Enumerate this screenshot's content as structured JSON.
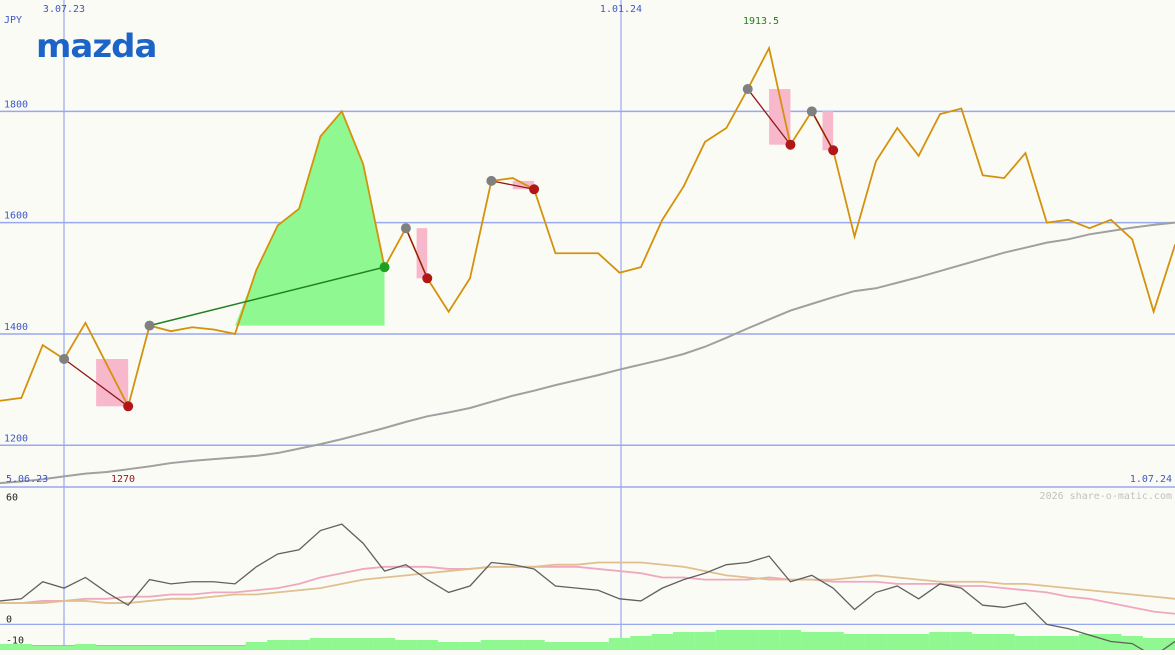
{
  "currency_label": "JPY",
  "logo_text": "mazda",
  "watermark": "2026 share-o-matic.com",
  "annotations": {
    "high_label": "1913.5",
    "low_label": "1270"
  },
  "colors": {
    "background": "#fbfbf6",
    "grid": "#9aa8f0",
    "price_line": "#d4920c",
    "moving_average": "#a0a0a0",
    "gain_fill": "#90f890",
    "loss_fill": "#f8b8cc",
    "logo_blue": "#1c64c8",
    "high_text": "#208020",
    "low_text": "#901818",
    "osc_main": "#606060",
    "osc_pink": "#f0a8c0",
    "osc_tan": "#e0c090",
    "volume": "#90f890"
  },
  "chart_data": [
    {
      "type": "line",
      "ylim": [
        1125,
        2000
      ],
      "yticks": [
        1200,
        1400,
        1600,
        1800
      ],
      "x_top_labels": [
        "3.07.23",
        "1.01.24"
      ],
      "x_bottom_labels": [
        "5.06.23",
        "1.07.24"
      ],
      "grid": true,
      "series": [
        {
          "role": "price",
          "values": [
            1280,
            1285,
            1380,
            1355,
            1420,
            1345,
            1270,
            1415,
            1405,
            1412,
            1408,
            1400,
            1515,
            1595,
            1625,
            1755,
            1800,
            1705,
            1520,
            1590,
            1500,
            1440,
            1500,
            1675,
            1680,
            1660,
            1545,
            1545,
            1545,
            1510,
            1520,
            1605,
            1665,
            1745,
            1770,
            1840,
            1913.5,
            1740,
            1800,
            1730,
            1575,
            1710,
            1770,
            1720,
            1795,
            1805,
            1685,
            1680,
            1725,
            1600,
            1605,
            1590,
            1605,
            1570,
            1440,
            1560
          ]
        },
        {
          "role": "moving-average",
          "values": [
            1132,
            1135,
            1139,
            1144,
            1149,
            1152,
            1157,
            1162,
            1168,
            1172,
            1175,
            1178,
            1181,
            1186,
            1194,
            1202,
            1211,
            1221,
            1231,
            1242,
            1252,
            1259,
            1267,
            1278,
            1289,
            1298,
            1308,
            1317,
            1326,
            1336,
            1345,
            1354,
            1364,
            1377,
            1393,
            1410,
            1426,
            1442,
            1454,
            1466,
            1477,
            1482,
            1492,
            1502,
            1513,
            1524,
            1535,
            1546,
            1555,
            1564,
            1570,
            1579,
            1585,
            1591,
            1596,
            1600
          ]
        }
      ],
      "swings": [
        {
          "from": 3,
          "to": 6,
          "kind": "loss"
        },
        {
          "from": 7,
          "to": 18,
          "kind": "gain"
        },
        {
          "from": 19,
          "to": 20,
          "kind": "loss"
        },
        {
          "from": 23,
          "to": 25,
          "kind": "loss"
        },
        {
          "from": 35,
          "to": 37,
          "kind": "loss"
        },
        {
          "from": 38,
          "to": 39,
          "kind": "loss"
        }
      ]
    },
    {
      "type": "line",
      "ylim": [
        -12,
        63
      ],
      "yticks": [
        60,
        0,
        -10
      ],
      "series": [
        {
          "role": "oscillator",
          "values": [
            11,
            12,
            20,
            17,
            22,
            15,
            9,
            21,
            19,
            20,
            20,
            19,
            27,
            33,
            35,
            44,
            47,
            38,
            25,
            28,
            21,
            15,
            18,
            29,
            28,
            26,
            18,
            17,
            16,
            12,
            11,
            17,
            21,
            24,
            28,
            29,
            32,
            20,
            23,
            17,
            7,
            15,
            18,
            12,
            19,
            17,
            9,
            8,
            10,
            0,
            -2,
            -5,
            -8,
            -9,
            -15,
            -8
          ]
        },
        {
          "role": "signal-pink",
          "values": [
            10,
            10,
            11,
            11,
            12,
            12,
            13,
            13,
            14,
            14,
            15,
            15,
            16,
            17,
            19,
            22,
            24,
            26,
            27,
            27,
            27,
            26,
            26,
            27,
            27,
            27,
            27,
            27,
            26,
            25,
            24,
            22,
            22,
            21,
            21,
            21,
            22,
            21,
            21,
            20,
            20,
            20,
            19,
            19,
            19,
            18,
            18,
            17,
            16,
            15,
            13,
            12,
            10,
            8,
            6,
            5
          ]
        },
        {
          "role": "signal-tan",
          "values": [
            10,
            10,
            10,
            11,
            11,
            10,
            10,
            11,
            12,
            12,
            13,
            14,
            14,
            15,
            16,
            17,
            19,
            21,
            22,
            23,
            24,
            25,
            26,
            27,
            27,
            27,
            28,
            28,
            29,
            29,
            29,
            28,
            27,
            25,
            23,
            22,
            21,
            21,
            21,
            21,
            22,
            23,
            22,
            21,
            20,
            20,
            20,
            19,
            19,
            18,
            17,
            16,
            15,
            14,
            13,
            12
          ]
        }
      ],
      "volume": [
        3,
        3,
        2,
        2,
        3,
        2,
        2,
        2,
        2,
        2,
        2,
        2,
        4,
        5,
        5,
        6,
        6,
        6,
        6,
        5,
        5,
        4,
        4,
        5,
        5,
        5,
        4,
        4,
        4,
        6,
        7,
        8,
        9,
        9,
        10,
        10,
        10,
        10,
        9,
        9,
        8,
        8,
        8,
        8,
        9,
        9,
        8,
        8,
        7,
        7,
        7,
        8,
        8,
        7,
        6,
        6
      ]
    }
  ]
}
